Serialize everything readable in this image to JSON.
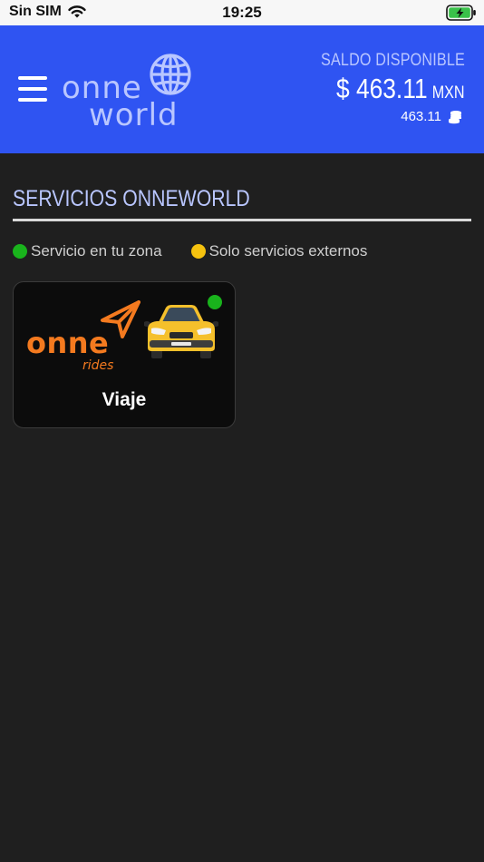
{
  "status_bar": {
    "carrier": "Sin SIM",
    "time": "19:25",
    "battery_state": "charging"
  },
  "header": {
    "background_color": "#2f54f2",
    "logo_text_line1": "onne",
    "logo_text_line2": "world",
    "balance_label": "SALDO DISPONIBLE",
    "balance_amount": "$ 463.11",
    "balance_currency": "MXN",
    "coins_value": "463.11"
  },
  "section": {
    "title": "SERVICIOS ONNEWORLD"
  },
  "legend": {
    "items": [
      {
        "label": "Servicio en tu zona",
        "color": "#19b31c"
      },
      {
        "label": "Solo servicios externos",
        "color": "#f5c20f"
      }
    ]
  },
  "services": [
    {
      "label": "Viaje",
      "logo_text": "onne",
      "logo_subtext": "rides",
      "status_color": "#19b31c",
      "brand_color": "#f47a1f"
    }
  ]
}
